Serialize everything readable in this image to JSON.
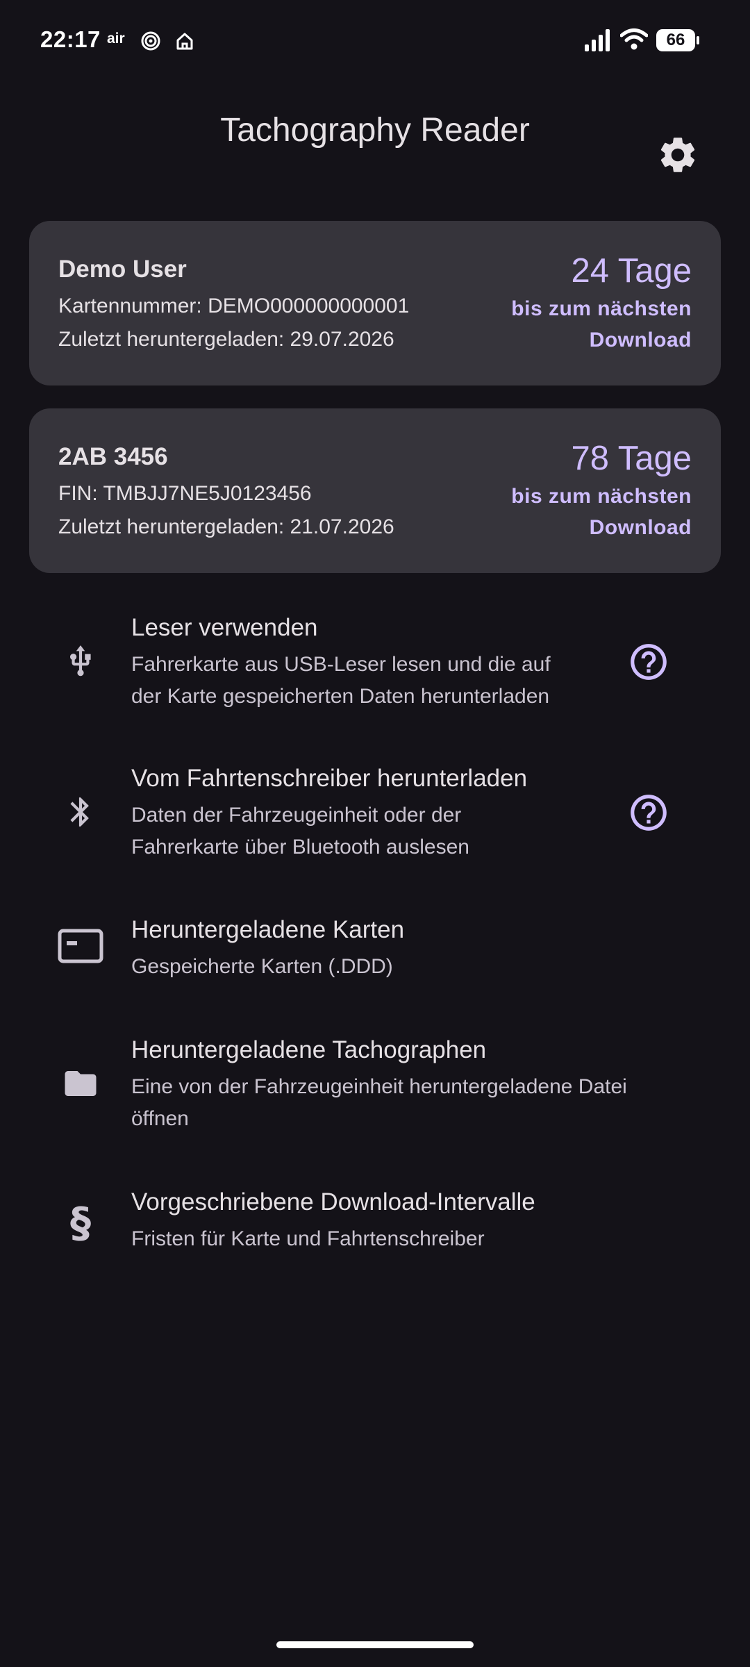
{
  "status_bar": {
    "time": "22:17",
    "air_label": "air",
    "battery": "66"
  },
  "header": {
    "title": "Tachography Reader"
  },
  "cards": [
    {
      "title": "Demo User",
      "line1": "Kartennummer: DEMO000000000001",
      "line2": "Zuletzt heruntergeladen: 29.07.2026",
      "days": "24 Tage",
      "sub1": "bis zum nächsten",
      "sub2": "Download"
    },
    {
      "title": "2AB 3456",
      "line1": "FIN: TMBJJ7NE5J0123456",
      "line2": "Zuletzt heruntergeladen: 21.07.2026",
      "days": "78 Tage",
      "sub1": "bis zum nächsten",
      "sub2": "Download"
    }
  ],
  "menu": [
    {
      "icon": "usb-icon",
      "title": "Leser verwenden",
      "desc1": "Fahrerkarte aus USB-Leser lesen und die auf",
      "desc2": "der Karte gespeicherten Daten herunterladen"
    },
    {
      "icon": "bluetooth-icon",
      "title": "Vom Fahrtenschreiber herunterladen",
      "desc1": "Daten der Fahrzeugeinheit oder der",
      "desc2": "Fahrerkarte über Bluetooth auslesen"
    },
    {
      "icon": "card-icon",
      "title": "Heruntergeladene Karten",
      "desc1": "Gespeicherte Karten (.DDD)"
    },
    {
      "icon": "folder-icon",
      "title": "Heruntergeladene Tachographen",
      "desc1": "Eine von der Fahrzeugeinheit heruntergeladene Datei",
      "desc2": "öffnen"
    },
    {
      "icon": "section-icon",
      "glyph": "§",
      "title": "Vorgeschriebene Download-Intervalle",
      "desc1": "Fristen für Karte und Fahrtenschreiber"
    }
  ],
  "colors": {
    "background": "#141218",
    "card": "#36343b",
    "accent": "#cfbdfe",
    "text": "#e6e1e5",
    "text_secondary": "#cac4d0"
  }
}
